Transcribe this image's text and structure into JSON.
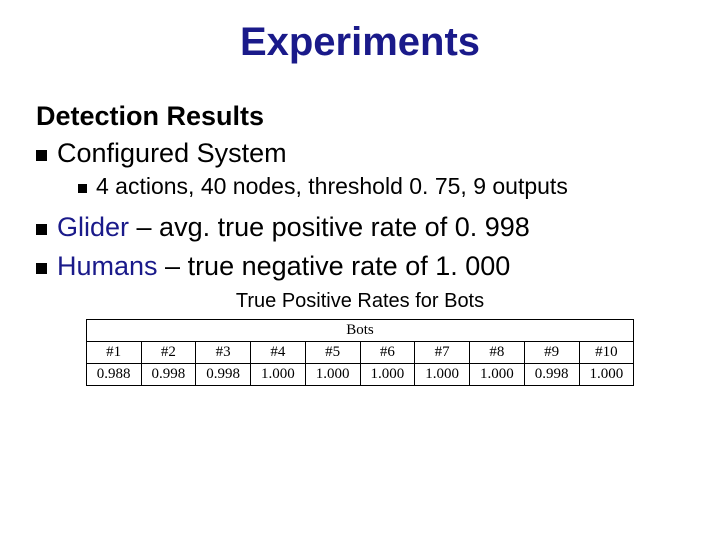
{
  "title": "Experiments",
  "section_heading": "Detection Results",
  "bullets": {
    "configured_label": "Configured System",
    "configured_detail": "4 actions, 40 nodes, threshold 0. 75, 9 outputs",
    "glider_label": "Glider",
    "glider_rest": " – avg. true positive rate of 0. 998",
    "humans_label": "Humans",
    "humans_rest": " – true negative rate of 1. 000"
  },
  "table_caption": "True Positive Rates for Bots",
  "chart_data": {
    "type": "table",
    "title": "True Positive Rates for Bots",
    "columns_header": "Bots",
    "columns": [
      "#1",
      "#2",
      "#3",
      "#4",
      "#5",
      "#6",
      "#7",
      "#8",
      "#9",
      "#10"
    ],
    "values": [
      0.988,
      0.998,
      0.998,
      1.0,
      1.0,
      1.0,
      1.0,
      1.0,
      0.998,
      1.0
    ]
  }
}
